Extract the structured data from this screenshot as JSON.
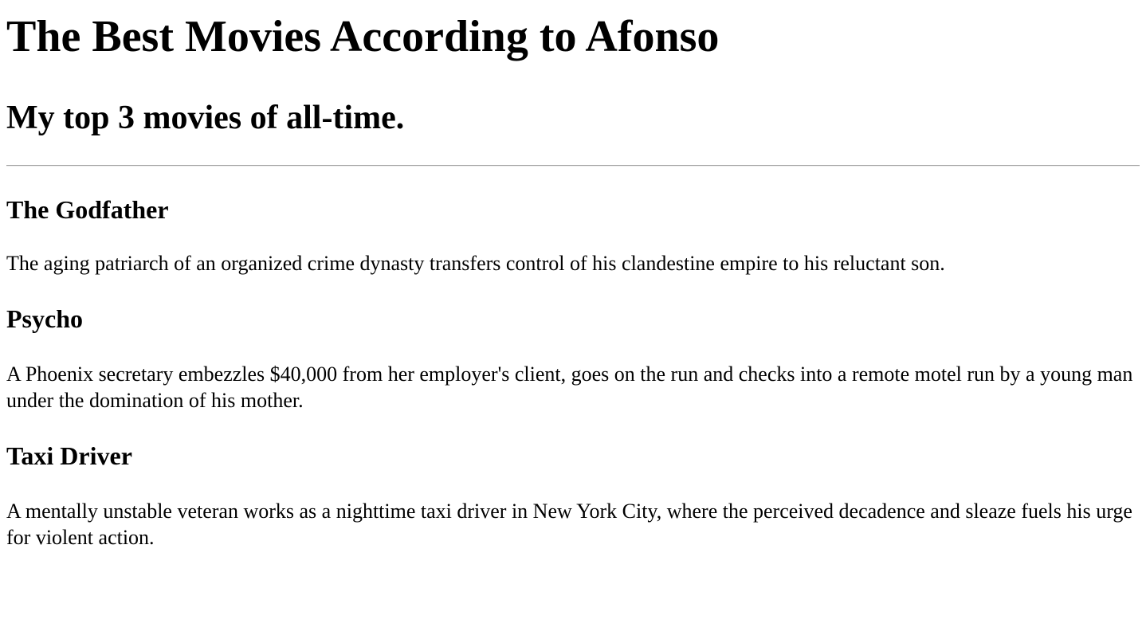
{
  "header": {
    "title": "The Best Movies According to Afonso",
    "subtitle": "My top 3 movies of all-time."
  },
  "movies": [
    {
      "title": "The Godfather",
      "description": "The aging patriarch of an organized crime dynasty transfers control of his clandestine empire to his reluctant son."
    },
    {
      "title": "Psycho",
      "description": "A Phoenix secretary embezzles $40,000 from her employer's client, goes on the run and checks into a remote motel run by a young man under the domination of his mother."
    },
    {
      "title": "Taxi Driver",
      "description": "A mentally unstable veteran works as a nighttime taxi driver in New York City, where the perceived decadence and sleaze fuels his urge for violent action."
    }
  ]
}
